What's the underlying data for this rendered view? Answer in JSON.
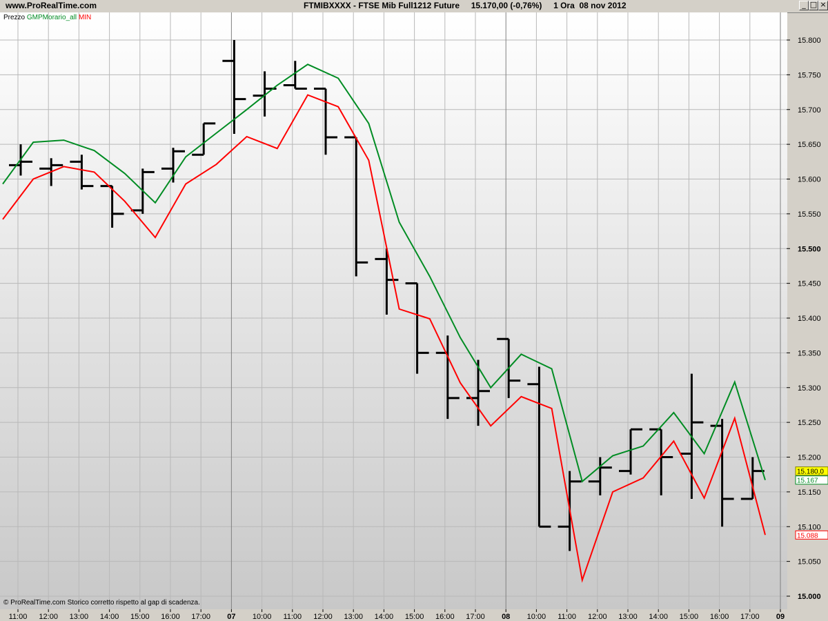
{
  "header": {
    "site": "www.ProRealTime.com",
    "title": "FTMIBXXXX - FTSE Mib Full1212 Future     15.170,00 (-0,76%)     1 Ora  08 nov 2012"
  },
  "legend": {
    "price": "Prezzo",
    "indicator": "GMPMorario_all",
    "min": "MIN"
  },
  "footnote": "© ProRealTime.com  Storico corretto rispetto al gap di scadenza.",
  "colors": {
    "bars": "#000000",
    "max_line": "#008c23",
    "min_line": "#ff0000",
    "last_price_bg": "#ffff00"
  },
  "chart_data": {
    "type": "line",
    "y_range": [
      15000,
      15800
    ],
    "y_ticks": [
      "15.800",
      "15.750",
      "15.700",
      "15.650",
      "15.600",
      "15.550",
      "15.500",
      "15.450",
      "15.400",
      "15.350",
      "15.300",
      "15.250",
      "15.200",
      "15.150",
      "15.100",
      "15.050",
      "15.000"
    ],
    "x_labels": [
      "11:00",
      "12:00",
      "13:00",
      "14:00",
      "15:00",
      "16:00",
      "17:00",
      "07",
      "10:00",
      "11:00",
      "12:00",
      "13:00",
      "14:00",
      "15:00",
      "16:00",
      "17:00",
      "08",
      "10:00",
      "11:00",
      "12:00",
      "13:00",
      "14:00",
      "15:00",
      "16:00",
      "17:00",
      "09"
    ],
    "ohlc": [
      {
        "o": 15620,
        "h": 15650,
        "l": 15605,
        "c": 15625
      },
      {
        "o": 15615,
        "h": 15630,
        "l": 15590,
        "c": 15620
      },
      {
        "o": 15625,
        "h": 15635,
        "l": 15585,
        "c": 15590
      },
      {
        "o": 15590,
        "h": 15590,
        "l": 15530,
        "c": 15550
      },
      {
        "o": 15555,
        "h": 15615,
        "l": 15550,
        "c": 15610
      },
      {
        "o": 15615,
        "h": 15645,
        "l": 15595,
        "c": 15640
      },
      {
        "o": 15635,
        "h": 15680,
        "l": 15635,
        "c": 15680
      },
      {
        "o": 15770,
        "h": 15800,
        "l": 15665,
        "c": 15715
      },
      {
        "o": 15720,
        "h": 15755,
        "l": 15690,
        "c": 15730
      },
      {
        "o": 15735,
        "h": 15770,
        "l": 15730,
        "c": 15730
      },
      {
        "o": 15730,
        "h": 15730,
        "l": 15635,
        "c": 15660
      },
      {
        "o": 15660,
        "h": 15660,
        "l": 15460,
        "c": 15480
      },
      {
        "o": 15485,
        "h": 15500,
        "l": 15405,
        "c": 15455
      },
      {
        "o": 15450,
        "h": 15450,
        "l": 15320,
        "c": 15350
      },
      {
        "o": 15350,
        "h": 15375,
        "l": 15255,
        "c": 15285
      },
      {
        "o": 15285,
        "h": 15340,
        "l": 15245,
        "c": 15295
      },
      {
        "o": 15370,
        "h": 15370,
        "l": 15285,
        "c": 15310
      },
      {
        "o": 15305,
        "h": 15330,
        "l": 15100,
        "c": 15100
      },
      {
        "o": 15100,
        "h": 15180,
        "l": 15065,
        "c": 15165
      },
      {
        "o": 15165,
        "h": 15200,
        "l": 15145,
        "c": 15185
      },
      {
        "o": 15180,
        "h": 15240,
        "l": 15175,
        "c": 15240
      },
      {
        "o": 15240,
        "h": 15240,
        "l": 15145,
        "c": 15200
      },
      {
        "o": 15205,
        "h": 15320,
        "l": 15140,
        "c": 15250
      },
      {
        "o": 15245,
        "h": 15255,
        "l": 15100,
        "c": 15140
      },
      {
        "o": 15140,
        "h": 15200,
        "l": 15140,
        "c": 15180
      }
    ],
    "series": [
      {
        "name": "GMPMorario_all",
        "color": "#008c23",
        "values": [
          15593,
          15653,
          15656,
          15641,
          15608,
          15566,
          15632,
          15666,
          15700,
          15735,
          15765,
          15745,
          15680,
          15538,
          15460,
          15372,
          15300,
          15348,
          15327,
          15165,
          15202,
          15216,
          15264,
          15205,
          15308,
          15167
        ]
      },
      {
        "name": "MIN",
        "color": "#ff0000",
        "values": [
          15542,
          15600,
          15618,
          15610,
          15568,
          15516,
          15593,
          15621,
          15661,
          15644,
          15721,
          15704,
          15627,
          15413,
          15399,
          15307,
          15245,
          15287,
          15270,
          15023,
          15150,
          15170,
          15223,
          15141,
          15256,
          15088
        ]
      }
    ],
    "price_labels": {
      "last_price": "15.180,0",
      "max_value": "15.167",
      "min_value": "15.088"
    },
    "grid": true
  }
}
